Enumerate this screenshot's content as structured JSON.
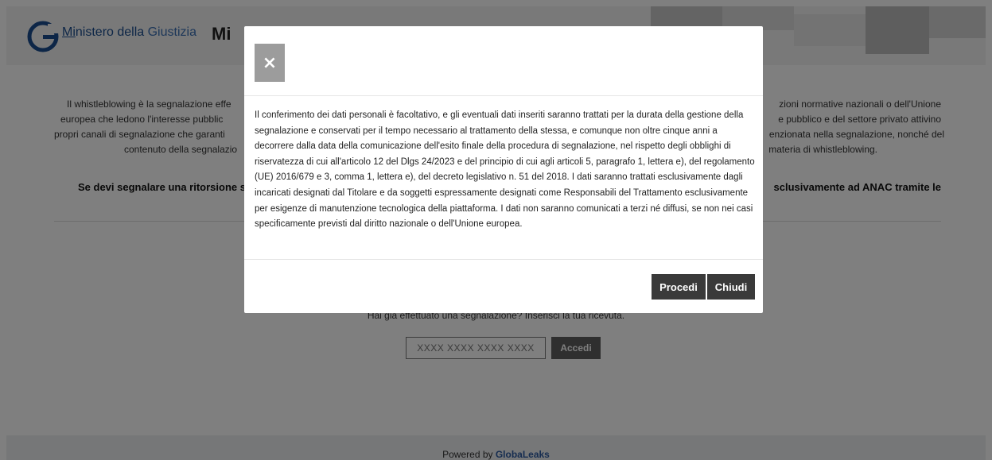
{
  "header": {
    "logo_letter": "G",
    "logo_text_prefix": "Mi",
    "logo_text_main": "nistero della ",
    "logo_text_accent": "Giustizia",
    "site_title": "Mi"
  },
  "main": {
    "intro_lines": [
      "Il whistleblowing è la segnalazione effe",
      "zioni normative nazionali o dell'Unione",
      "europea che ledono l'interesse pubblic",
      "e pubblico e del settore privato attivino",
      "propri canali di segnalazione che garanti",
      "enzionata nella segnalazione, nonché del",
      "contenuto della segnalazio",
      "materia di whistleblowing."
    ],
    "retaliation_left": "Se devi segnalare una ritorsione s",
    "retaliation_right": "sclusivamente ad ANAC tramite le",
    "receipt_label": "Hai già effettuato una segnalazione? Inserisci la tua ricevuta.",
    "receipt_placeholder": "XXXX XXXX XXXX XXXX",
    "access_label": "Accedi"
  },
  "footer": {
    "powered_prefix": "Powered by ",
    "powered_brand": "GlobaLeaks"
  },
  "modal": {
    "close_label": "×",
    "body_text": "Il conferimento dei dati personali è facoltativo, e gli eventuali dati inseriti saranno trattati per la durata della gestione della segnalazione e conservati per il tempo necessario al trattamento della stessa, e comunque non oltre cinque anni a decorrere dalla data della comunicazione dell'esito finale della procedura di segnalazione, nel rispetto degli obblighi di riservatezza di cui all'articolo 12 del Dlgs 24/2023 e del principio di cui agli articoli 5, paragrafo 1, lettera e), del regolamento (UE) 2016/679 e 3, comma 1, lettera e), del decreto legislativo n. 51 del 2018. I dati saranno trattati esclusivamente dagli incaricati designati dal Titolare e da soggetti espressamente designati come Responsabili del Trattamento esclusivamente per esigenze di manutenzione tecnologica della piattaforma. I dati non saranno comunicati a terzi né diffusi, se non nei casi specificamente previsti dal diritto nazionale o dell'Unione europea.",
    "proceed_label": "Procedi",
    "close_button_label": "Chiudi"
  },
  "colors": {
    "overlay": "#000000",
    "brand_blue": "#1a4d8f",
    "button_dark": "#3a3a3a",
    "close_gray": "#9c9c9c"
  }
}
